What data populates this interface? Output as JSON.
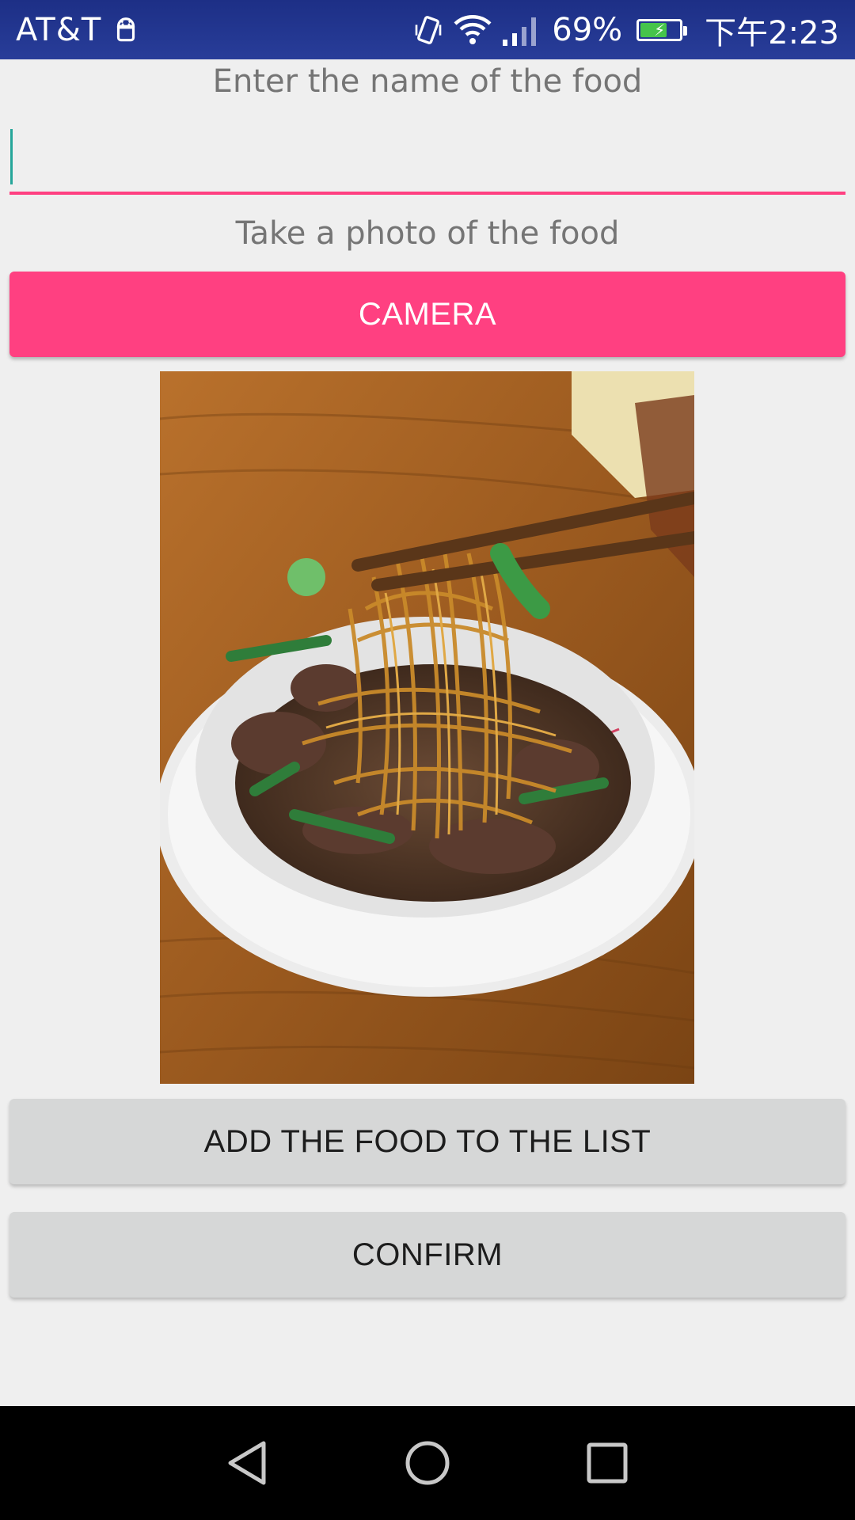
{
  "status_bar": {
    "carrier": "AT&T",
    "battery_percent": "69%",
    "battery_level": 0.69,
    "time": "下午2:23",
    "icons": [
      "android-icon",
      "vibrate-icon",
      "wifi-icon",
      "signal-icon",
      "battery-charging-icon"
    ]
  },
  "form": {
    "name_prompt": "Enter the name of the food",
    "name_value": "",
    "photo_prompt": "Take a photo of the food",
    "camera_label": "CAMERA",
    "add_label": "ADD THE FOOD TO THE LIST",
    "confirm_label": "CONFIRM"
  },
  "colors": {
    "accent": "#ff4081",
    "status_bar": "#283d99",
    "cursor": "#26a69a",
    "button_gray": "#d6d7d7"
  },
  "nav_bar": {
    "icons": [
      "back-icon",
      "home-icon",
      "recents-icon"
    ]
  }
}
